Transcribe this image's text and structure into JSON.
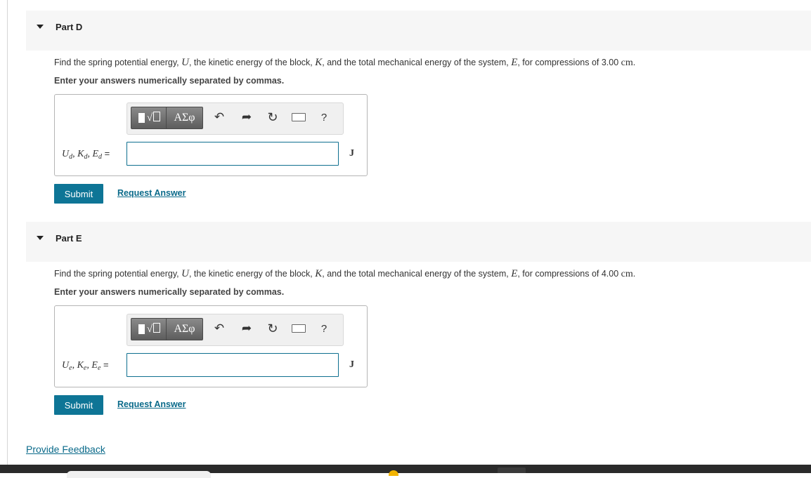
{
  "parts": [
    {
      "title": "Part D",
      "question": {
        "t1": "Find the spring potential energy, ",
        "v1": "U",
        "t2": ", the kinetic energy of the block, ",
        "v2": "K",
        "t3": ", and the total mechanical energy of the system, ",
        "v3": "E",
        "t4": ", for compressions of 3.00 ",
        "unit": "cm",
        "t5": "."
      },
      "instruction": "Enter your answers numerically separated by commas.",
      "label": {
        "a": "U",
        "b": "K",
        "c": "E",
        "sub": "d",
        "sep": ", ",
        "eq": " ="
      },
      "input_value": "",
      "answer_unit": "J",
      "submit_label": "Submit",
      "request_label": "Request Answer"
    },
    {
      "title": "Part E",
      "question": {
        "t1": "Find the spring potential energy, ",
        "v1": "U",
        "t2": ", the kinetic energy of the block, ",
        "v2": "K",
        "t3": ", and the total mechanical energy of the system, ",
        "v3": "E",
        "t4": ", for compressions of 4.00 ",
        "unit": "cm",
        "t5": "."
      },
      "instruction": "Enter your answers numerically separated by commas.",
      "label": {
        "a": "U",
        "b": "K",
        "c": "E",
        "sub": "e",
        "sep": ", ",
        "eq": " ="
      },
      "input_value": "",
      "answer_unit": "J",
      "submit_label": "Submit",
      "request_label": "Request Answer"
    }
  ],
  "toolbar": {
    "templates_icon": "templates-icon",
    "symbols_label": "ΑΣφ",
    "undo_icon": "undo-icon",
    "redo_icon": "redo-icon",
    "reset_icon": "reset-icon",
    "keyboard_icon": "keyboard-icon",
    "help_label": "?"
  },
  "feedback_label": "Provide Feedback",
  "colors": {
    "accent": "#0e7596",
    "link": "#0a6a8a",
    "input_border": "#0e6f8f"
  }
}
